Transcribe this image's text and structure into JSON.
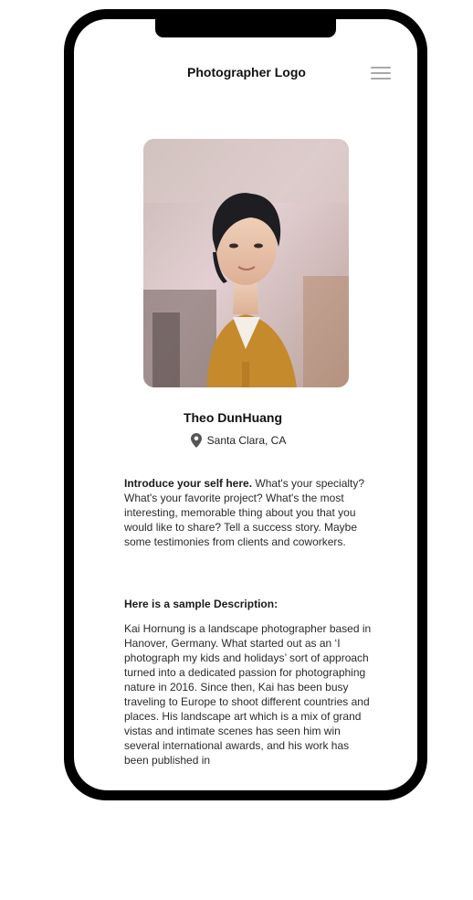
{
  "header": {
    "logo_text": "Photographer Logo",
    "menu_icon": "hamburger-icon"
  },
  "profile": {
    "name": "Theo DunHuang",
    "location": "Santa Clara, CA",
    "location_icon": "location-pin-icon"
  },
  "intro": {
    "lead": "Introduce your self here.",
    "body": "What's your specialty? What's your favorite project? What's the most interesting, memorable thing about you that you would like to share? Tell a success story. Maybe some testimonies from clients and coworkers."
  },
  "sample": {
    "heading": "Here is a sample Description:",
    "body": "Kai Hornung is a landscape photographer based in Hanover, Germany. What started out as an ‘I photograph my kids and holidays’ sort of approach turned into a dedicated passion for photographing nature in 2016. Since then, Kai has been busy traveling to Europe to shoot different countries and places. His landscape art which is a mix of grand vistas and intimate scenes has seen him win several international awards, and his work has been published in"
  },
  "colors": {
    "phone_frame": "#000000",
    "sweater": "#c58a2c",
    "menu": "#a8a8a8"
  }
}
